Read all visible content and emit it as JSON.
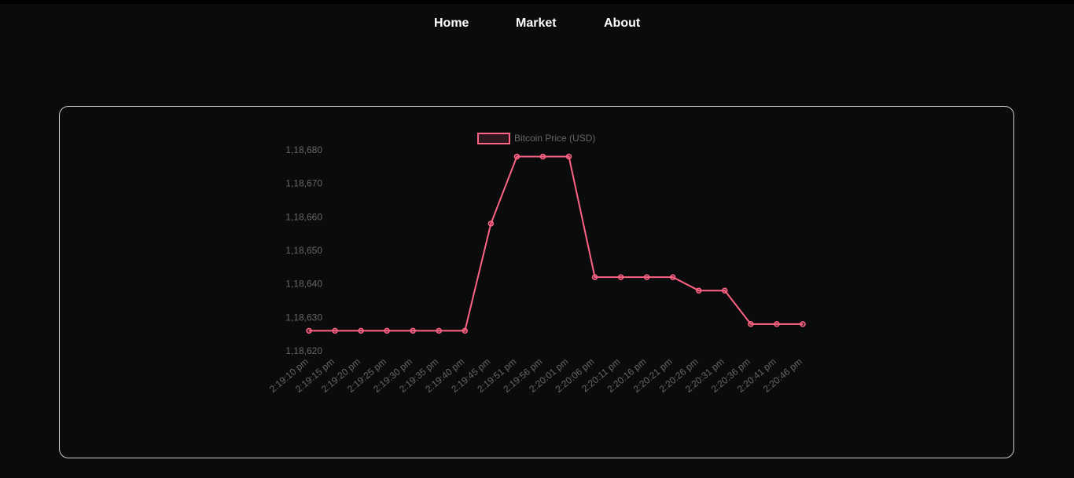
{
  "nav": {
    "items": [
      {
        "label": "Home"
      },
      {
        "label": "Market"
      },
      {
        "label": "About"
      }
    ]
  },
  "colors": {
    "background": "#0a0b0d",
    "line": "#ff6384",
    "text": "#ffffff",
    "tick": "#666666",
    "card_border": "#cfcfcf"
  },
  "chart_data": {
    "type": "line",
    "title": "",
    "xlabel": "",
    "ylabel": "",
    "legend_position": "top",
    "grid": false,
    "categories": [
      "2:19:10 pm",
      "2:19:15 pm",
      "2:19:20 pm",
      "2:19:25 pm",
      "2:19:30 pm",
      "2:19:35 pm",
      "2:19:40 pm",
      "2:19:45 pm",
      "2:19:51 pm",
      "2:19:56 pm",
      "2:20:01 pm",
      "2:20:06 pm",
      "2:20:11 pm",
      "2:20:16 pm",
      "2:20:21 pm",
      "2:20:26 pm",
      "2:20:31 pm",
      "2:20:36 pm",
      "2:20:41 pm",
      "2:20:46 pm"
    ],
    "series": [
      {
        "name": "Bitcoin Price (USD)",
        "color": "#ff6384",
        "values": [
          118626,
          118626,
          118626,
          118626,
          118626,
          118626,
          118626,
          118658,
          118678,
          118678,
          118678,
          118642,
          118642,
          118642,
          118642,
          118638,
          118638,
          118628,
          118628,
          118628
        ]
      }
    ],
    "yticks": [
      "1,18,620",
      "1,18,630",
      "1,18,640",
      "1,18,650",
      "1,18,660",
      "1,18,670",
      "1,18,680"
    ],
    "ylim": [
      118620,
      118680
    ]
  }
}
